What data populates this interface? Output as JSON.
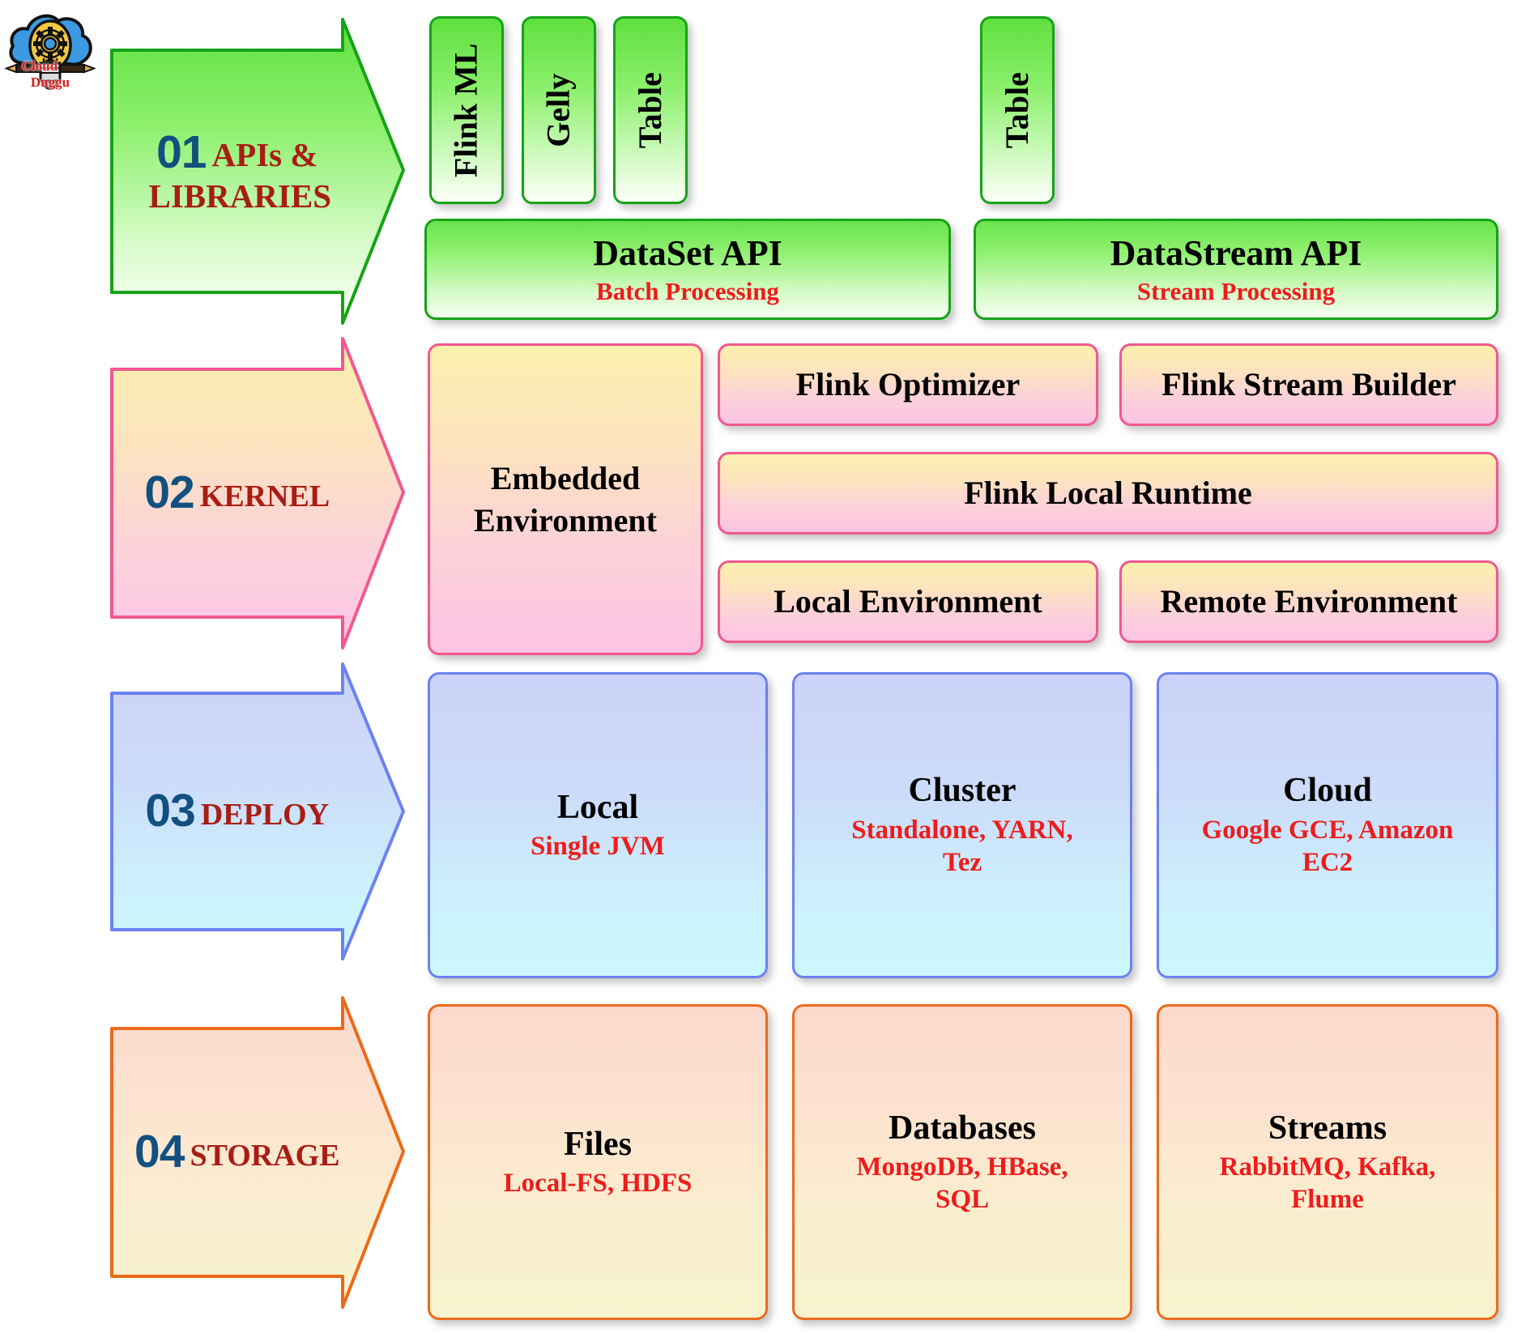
{
  "logo": {
    "name": "cloudduggu-logo",
    "text_left": "Cloud",
    "text_right": "Duggu",
    "text_color": "#e01b1b",
    "cloud_color": "#3b9ae1",
    "bulb_color": "#f5c842"
  },
  "colors": {
    "number": "#11507f",
    "layer_word": "#a81d14",
    "sub_red": "#ee1c1c",
    "green_border": "#17a317",
    "pink_border": "#f2588f",
    "blue_border": "#6c82ef",
    "orange_border": "#ec6a1b"
  },
  "layers": [
    {
      "number": "01",
      "word": "APIs &",
      "word2": "LIBRARIES"
    },
    {
      "number": "02",
      "word": "KERNEL"
    },
    {
      "number": "03",
      "word": "DEPLOY"
    },
    {
      "number": "04",
      "word": "STORAGE"
    }
  ],
  "row1": {
    "vertical_boxes": [
      {
        "label": "Flink ML"
      },
      {
        "label": "Gelly"
      },
      {
        "label": "Table"
      },
      {
        "label": "Table"
      }
    ],
    "api_boxes": [
      {
        "title": "DataSet API",
        "sub": "Batch Processing"
      },
      {
        "title": "DataStream API",
        "sub": "Stream Processing"
      }
    ]
  },
  "row2": {
    "embedded": {
      "title": "Embedded Environment"
    },
    "boxes": [
      {
        "title": "Flink Optimizer"
      },
      {
        "title": "Flink Stream Builder"
      },
      {
        "title": "Flink Local Runtime"
      },
      {
        "title": "Local Environment"
      },
      {
        "title": "Remote Environment"
      }
    ]
  },
  "row3": {
    "boxes": [
      {
        "title": "Local",
        "sub": "Single JVM"
      },
      {
        "title": "Cluster",
        "sub": "Standalone, YARN, Tez"
      },
      {
        "title": "Cloud",
        "sub": "Google GCE, Amazon EC2"
      }
    ]
  },
  "row4": {
    "boxes": [
      {
        "title": "Files",
        "sub": "Local-FS, HDFS"
      },
      {
        "title": "Databases",
        "sub": "MongoDB, HBase, SQL"
      },
      {
        "title": "Streams",
        "sub": "RabbitMQ, Kafka, Flume"
      }
    ]
  }
}
